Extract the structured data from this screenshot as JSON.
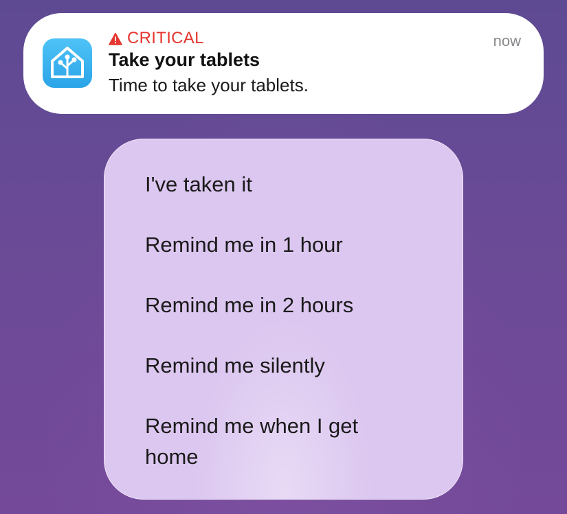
{
  "notification": {
    "critical_label": "CRITICAL",
    "title": "Take your tablets",
    "body": "Time to take your tablets.",
    "time": "now",
    "app_icon": "home-assistant-icon",
    "warning_icon": "warning-triangle-icon",
    "critical_color": "#e5362f"
  },
  "actions": [
    {
      "label": "I've taken it"
    },
    {
      "label": "Remind me in 1 hour"
    },
    {
      "label": "Remind me in 2 hours"
    },
    {
      "label": "Remind me silently"
    },
    {
      "label": "Remind me when I get home"
    }
  ]
}
